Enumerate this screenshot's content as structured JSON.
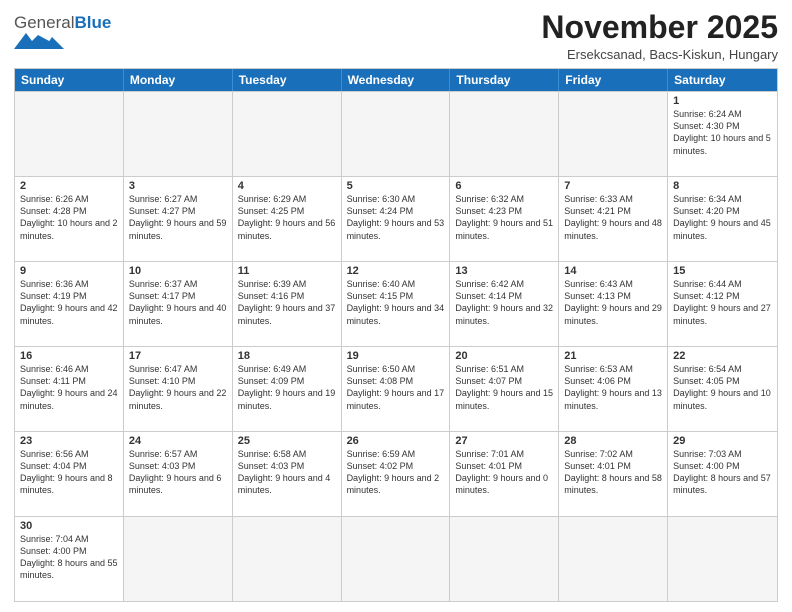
{
  "logo": {
    "text_general": "General",
    "text_blue": "Blue"
  },
  "title": "November 2025",
  "location": "Ersekcsanad, Bacs-Kiskun, Hungary",
  "header_days": [
    "Sunday",
    "Monday",
    "Tuesday",
    "Wednesday",
    "Thursday",
    "Friday",
    "Saturday"
  ],
  "weeks": [
    [
      {
        "day": "",
        "info": ""
      },
      {
        "day": "",
        "info": ""
      },
      {
        "day": "",
        "info": ""
      },
      {
        "day": "",
        "info": ""
      },
      {
        "day": "",
        "info": ""
      },
      {
        "day": "",
        "info": ""
      },
      {
        "day": "1",
        "info": "Sunrise: 6:24 AM\nSunset: 4:30 PM\nDaylight: 10 hours and 5 minutes."
      }
    ],
    [
      {
        "day": "2",
        "info": "Sunrise: 6:26 AM\nSunset: 4:28 PM\nDaylight: 10 hours and 2 minutes."
      },
      {
        "day": "3",
        "info": "Sunrise: 6:27 AM\nSunset: 4:27 PM\nDaylight: 9 hours and 59 minutes."
      },
      {
        "day": "4",
        "info": "Sunrise: 6:29 AM\nSunset: 4:25 PM\nDaylight: 9 hours and 56 minutes."
      },
      {
        "day": "5",
        "info": "Sunrise: 6:30 AM\nSunset: 4:24 PM\nDaylight: 9 hours and 53 minutes."
      },
      {
        "day": "6",
        "info": "Sunrise: 6:32 AM\nSunset: 4:23 PM\nDaylight: 9 hours and 51 minutes."
      },
      {
        "day": "7",
        "info": "Sunrise: 6:33 AM\nSunset: 4:21 PM\nDaylight: 9 hours and 48 minutes."
      },
      {
        "day": "8",
        "info": "Sunrise: 6:34 AM\nSunset: 4:20 PM\nDaylight: 9 hours and 45 minutes."
      }
    ],
    [
      {
        "day": "9",
        "info": "Sunrise: 6:36 AM\nSunset: 4:19 PM\nDaylight: 9 hours and 42 minutes."
      },
      {
        "day": "10",
        "info": "Sunrise: 6:37 AM\nSunset: 4:17 PM\nDaylight: 9 hours and 40 minutes."
      },
      {
        "day": "11",
        "info": "Sunrise: 6:39 AM\nSunset: 4:16 PM\nDaylight: 9 hours and 37 minutes."
      },
      {
        "day": "12",
        "info": "Sunrise: 6:40 AM\nSunset: 4:15 PM\nDaylight: 9 hours and 34 minutes."
      },
      {
        "day": "13",
        "info": "Sunrise: 6:42 AM\nSunset: 4:14 PM\nDaylight: 9 hours and 32 minutes."
      },
      {
        "day": "14",
        "info": "Sunrise: 6:43 AM\nSunset: 4:13 PM\nDaylight: 9 hours and 29 minutes."
      },
      {
        "day": "15",
        "info": "Sunrise: 6:44 AM\nSunset: 4:12 PM\nDaylight: 9 hours and 27 minutes."
      }
    ],
    [
      {
        "day": "16",
        "info": "Sunrise: 6:46 AM\nSunset: 4:11 PM\nDaylight: 9 hours and 24 minutes."
      },
      {
        "day": "17",
        "info": "Sunrise: 6:47 AM\nSunset: 4:10 PM\nDaylight: 9 hours and 22 minutes."
      },
      {
        "day": "18",
        "info": "Sunrise: 6:49 AM\nSunset: 4:09 PM\nDaylight: 9 hours and 19 minutes."
      },
      {
        "day": "19",
        "info": "Sunrise: 6:50 AM\nSunset: 4:08 PM\nDaylight: 9 hours and 17 minutes."
      },
      {
        "day": "20",
        "info": "Sunrise: 6:51 AM\nSunset: 4:07 PM\nDaylight: 9 hours and 15 minutes."
      },
      {
        "day": "21",
        "info": "Sunrise: 6:53 AM\nSunset: 4:06 PM\nDaylight: 9 hours and 13 minutes."
      },
      {
        "day": "22",
        "info": "Sunrise: 6:54 AM\nSunset: 4:05 PM\nDaylight: 9 hours and 10 minutes."
      }
    ],
    [
      {
        "day": "23",
        "info": "Sunrise: 6:56 AM\nSunset: 4:04 PM\nDaylight: 9 hours and 8 minutes."
      },
      {
        "day": "24",
        "info": "Sunrise: 6:57 AM\nSunset: 4:03 PM\nDaylight: 9 hours and 6 minutes."
      },
      {
        "day": "25",
        "info": "Sunrise: 6:58 AM\nSunset: 4:03 PM\nDaylight: 9 hours and 4 minutes."
      },
      {
        "day": "26",
        "info": "Sunrise: 6:59 AM\nSunset: 4:02 PM\nDaylight: 9 hours and 2 minutes."
      },
      {
        "day": "27",
        "info": "Sunrise: 7:01 AM\nSunset: 4:01 PM\nDaylight: 9 hours and 0 minutes."
      },
      {
        "day": "28",
        "info": "Sunrise: 7:02 AM\nSunset: 4:01 PM\nDaylight: 8 hours and 58 minutes."
      },
      {
        "day": "29",
        "info": "Sunrise: 7:03 AM\nSunset: 4:00 PM\nDaylight: 8 hours and 57 minutes."
      }
    ],
    [
      {
        "day": "30",
        "info": "Sunrise: 7:04 AM\nSunset: 4:00 PM\nDaylight: 8 hours and 55 minutes."
      },
      {
        "day": "",
        "info": ""
      },
      {
        "day": "",
        "info": ""
      },
      {
        "day": "",
        "info": ""
      },
      {
        "day": "",
        "info": ""
      },
      {
        "day": "",
        "info": ""
      },
      {
        "day": "",
        "info": ""
      }
    ]
  ]
}
